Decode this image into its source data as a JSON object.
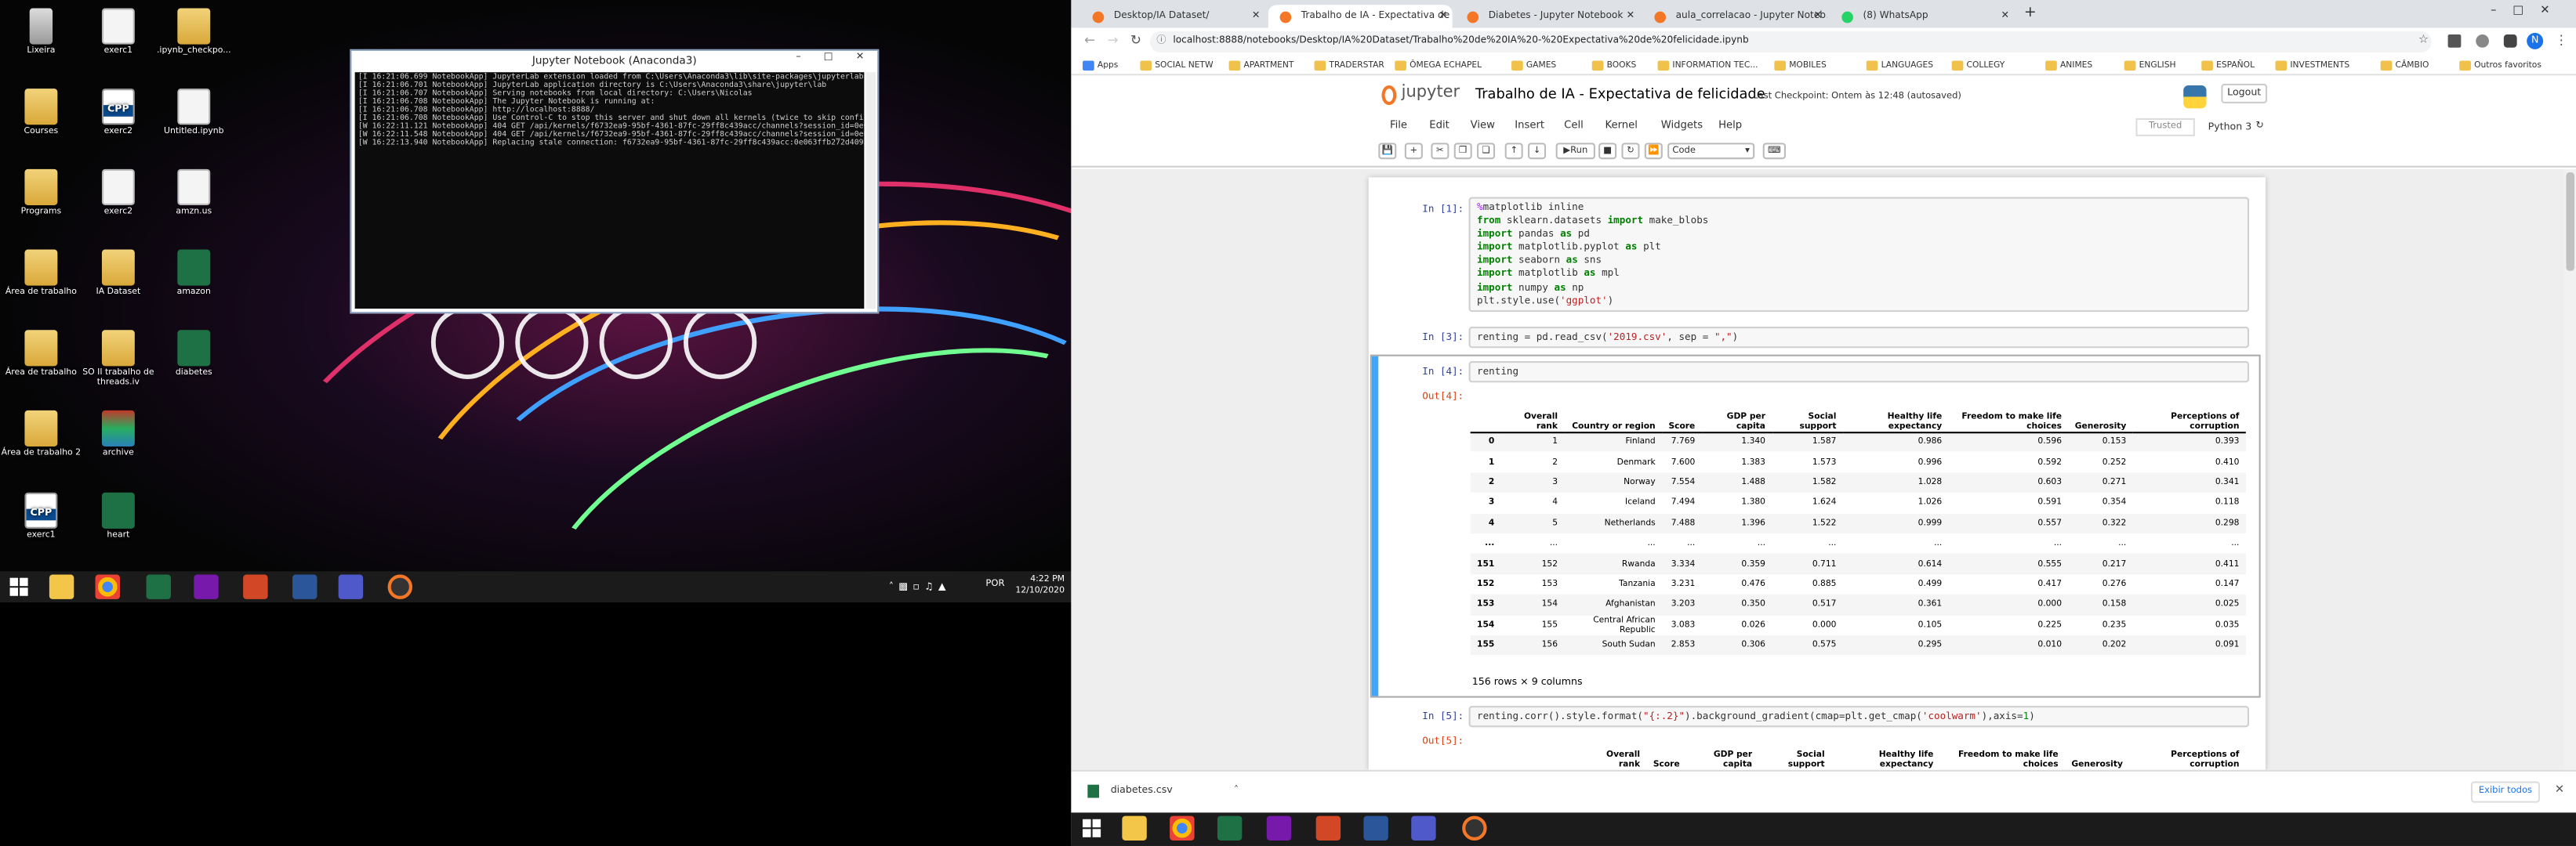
{
  "desktop": {
    "icons": [
      {
        "label": "Lixeira",
        "kind": "bin"
      },
      {
        "label": "exerc1",
        "kind": "doc"
      },
      {
        "label": ".ipynb_checkpo...",
        "kind": "folder"
      },
      {
        "label": "Courses",
        "kind": "folder"
      },
      {
        "label": "exerc2",
        "kind": "cpp"
      },
      {
        "label": "Untitled.ipynb",
        "kind": "doc"
      },
      {
        "label": "Programs",
        "kind": "folder"
      },
      {
        "label": "exerc2",
        "kind": "doc"
      },
      {
        "label": "amzn.us",
        "kind": "doc"
      },
      {
        "label": "Área de trabalho",
        "kind": "folder"
      },
      {
        "label": "IA Dataset",
        "kind": "folder"
      },
      {
        "label": "amazon",
        "kind": "excel"
      },
      {
        "label": "Área de trabalho",
        "kind": "folder"
      },
      {
        "label": "SO II trabalho de threads.iv",
        "kind": "folder"
      },
      {
        "label": "diabetes",
        "kind": "excel"
      },
      {
        "label": "Área de trabalho 2",
        "kind": "folder"
      },
      {
        "label": "archive",
        "kind": "zip"
      },
      {
        "label": "exerc1",
        "kind": "cpp"
      },
      {
        "label": "heart",
        "kind": "excel"
      }
    ]
  },
  "terminal": {
    "title": "Jupyter Notebook (Anaconda3)",
    "log": "[I 16:21:06.699 NotebookApp] JupyterLab extension loaded from C:\\Users\\Anaconda3\\lib\\site-packages\\jupyterlab\n[I 16:21:06.701 NotebookApp] JupyterLab application directory is C:\\Users\\Anaconda3\\share\\jupyter\\lab\n[I 16:21:06.707 NotebookApp] Serving notebooks from local directory: C:\\Users\\Nicolas\n[I 16:21:06.708 NotebookApp] The Jupyter Notebook is running at:\n[I 16:21:06.708 NotebookApp] http://localhost:8888/\n[I 16:21:06.708 NotebookApp] Use Control-C to stop this server and shut down all kernels (twice to skip confirmation).\n[W 16:22:11.121 NotebookApp] 404 GET /api/kernels/f6732ea9-95bf-4361-87fc-29ff8c439acc/channels?session_id=0e063ffb272d4093aac465427d05686a (::1): Kernel does not exist: f6732ea9-95bf-4361-87fc-29ff8c439acc\n[W 16:22:11.548 NotebookApp] 404 GET /api/kernels/f6732ea9-95bf-4361-87fc-29ff8c439acc/channels?session_id=0e063ffb272d4093aac465427d05686a (::1) 425.61ms referer=None\n[W 16:22:13.940 NotebookApp] Replacing stale connection: f6732ea9-95bf-4361-87fc-29ff8c439acc:0e063ffb272d4093aac465427d05686a"
  },
  "taskbar_left": {
    "lang": "POR",
    "time": "4:22 PM",
    "date": "12/10/2020"
  },
  "browser": {
    "tabs": [
      {
        "label": "Desktop/IA Dataset/",
        "active": false,
        "color": "#f37726"
      },
      {
        "label": "Trabalho de IA - Expectativa de f",
        "active": true,
        "color": "#f37726"
      },
      {
        "label": "Diabetes - Jupyter Notebook",
        "active": false,
        "color": "#f37726"
      },
      {
        "label": "aula_correlacao - Jupyter Noteb...",
        "active": false,
        "color": "#f37726"
      },
      {
        "label": "(8) WhatsApp",
        "active": false,
        "color": "#25d366"
      }
    ],
    "url": "localhost:8888/notebooks/Desktop/IA%20Dataset/Trabalho%20de%20IA%20-%20Expectativa%20de%20felicidade.ipynb",
    "profile_initial": "N",
    "bookmarks": [
      "Apps",
      "SOCIAL NETW",
      "APARTMENT",
      "TRADERSTAR",
      "ÔMEGA ECHAPEL",
      "GAMES",
      "BOOKS",
      "INFORMATION TEC...",
      "MOBILES",
      "LANGUAGES",
      "COLLEGY",
      "ANIMES",
      "ENGLISH",
      "ESPAÑOL",
      "INVESTMENTS",
      "CÂMBIO"
    ],
    "other_bookmarks": "Outros favoritos"
  },
  "jupyter": {
    "logo": "jupyter",
    "title": "Trabalho de IA - Expectativa de felicidade",
    "checkpoint": "Last Checkpoint: Ontem às 12:48  (autosaved)",
    "logout": "Logout",
    "menu": [
      "File",
      "Edit",
      "View",
      "Insert",
      "Cell",
      "Kernel",
      "Widgets",
      "Help"
    ],
    "trusted": "Trusted",
    "kernel": "Python 3",
    "run_label": "Run",
    "cell_type": "Code"
  },
  "cells": {
    "c1": {
      "prompt": "In [1]:"
    },
    "c3": {
      "prompt": "In [3]:"
    },
    "c4": {
      "prompt": "In [4]:",
      "code": "renting",
      "out_prompt": "Out[4]:",
      "summary": "156 rows × 9 columns"
    },
    "c5": {
      "prompt": "In [5]:",
      "out_prompt": "Out[5]:"
    }
  },
  "dataframe": {
    "headers": [
      "",
      "Overall rank",
      "Country or region",
      "Score",
      "GDP per capita",
      "Social support",
      "Healthy life expectancy",
      "Freedom to make life choices",
      "Generosity",
      "Perceptions of corruption"
    ],
    "rows": [
      [
        "0",
        "1",
        "Finland",
        "7.769",
        "1.340",
        "1.587",
        "0.986",
        "0.596",
        "0.153",
        "0.393"
      ],
      [
        "1",
        "2",
        "Denmark",
        "7.600",
        "1.383",
        "1.573",
        "0.996",
        "0.592",
        "0.252",
        "0.410"
      ],
      [
        "2",
        "3",
        "Norway",
        "7.554",
        "1.488",
        "1.582",
        "1.028",
        "0.603",
        "0.271",
        "0.341"
      ],
      [
        "3",
        "4",
        "Iceland",
        "7.494",
        "1.380",
        "1.624",
        "1.026",
        "0.591",
        "0.354",
        "0.118"
      ],
      [
        "4",
        "5",
        "Netherlands",
        "7.488",
        "1.396",
        "1.522",
        "0.999",
        "0.557",
        "0.322",
        "0.298"
      ],
      [
        "...",
        "...",
        "...",
        "...",
        "...",
        "...",
        "...",
        "...",
        "...",
        "..."
      ],
      [
        "151",
        "152",
        "Rwanda",
        "3.334",
        "0.359",
        "0.711",
        "0.614",
        "0.555",
        "0.217",
        "0.411"
      ],
      [
        "152",
        "153",
        "Tanzania",
        "3.231",
        "0.476",
        "0.885",
        "0.499",
        "0.417",
        "0.276",
        "0.147"
      ],
      [
        "153",
        "154",
        "Afghanistan",
        "3.203",
        "0.350",
        "0.517",
        "0.361",
        "0.000",
        "0.158",
        "0.025"
      ],
      [
        "154",
        "155",
        "Central African Republic",
        "3.083",
        "0.026",
        "0.000",
        "0.105",
        "0.225",
        "0.235",
        "0.035"
      ],
      [
        "155",
        "156",
        "South Sudan",
        "2.853",
        "0.306",
        "0.575",
        "0.295",
        "0.010",
        "0.202",
        "0.091"
      ]
    ]
  },
  "corr_headers": [
    "Overall rank",
    "Score",
    "GDP per capita",
    "Social support",
    "Healthy life expectancy",
    "Freedom to make life choices",
    "Generosity",
    "Perceptions of corruption"
  ],
  "download": {
    "file": "diabetes.csv",
    "show_all": "Exibir todos"
  }
}
